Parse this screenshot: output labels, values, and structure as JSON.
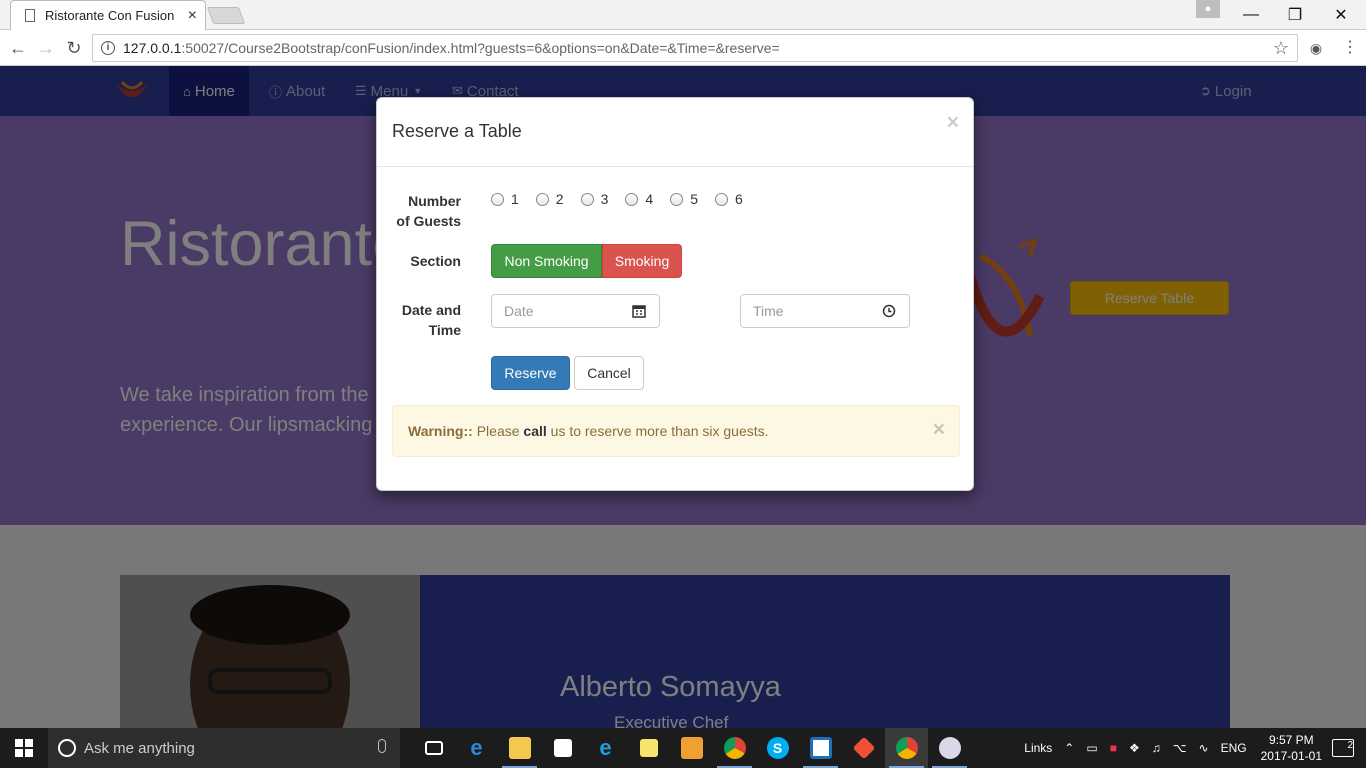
{
  "browser": {
    "tab_title": "Ristorante Con Fusion",
    "tab_close": "×",
    "url_host": "127.0.0.1",
    "url_rest": ":50027/Course2Bootstrap/conFusion/index.html?guests=6&options=on&Date=&Time=&reserve=",
    "window_controls": {
      "minimize": "—",
      "restore": "❐",
      "close": "✕"
    }
  },
  "navbar": {
    "items": [
      {
        "label": "Home",
        "icon": "home-icon",
        "active": true
      },
      {
        "label": "About",
        "icon": "info-icon"
      },
      {
        "label": "Menu",
        "icon": "list-icon"
      },
      {
        "label": "Contact",
        "icon": "envelope-icon"
      }
    ],
    "login_label": "Login"
  },
  "jumbotron": {
    "title": "Ristorante",
    "text_line1": "We take inspiration from the",
    "text_line2": "experience. Our lipsmacking",
    "button_label": "Reserve Table"
  },
  "leader": {
    "name": "Alberto Somayya",
    "title": "Executive Chef"
  },
  "modal": {
    "title": "Reserve a Table",
    "close": "×",
    "guests_label_1": "Number",
    "guests_label_2": "of Guests",
    "guest_options": [
      "1",
      "2",
      "3",
      "4",
      "5",
      "6"
    ],
    "section_label": "Section",
    "non_smoking_label": "Non Smoking",
    "smoking_label": "Smoking",
    "date_label_1": "Date and",
    "date_label_2": "Time",
    "date_placeholder": "Date",
    "time_placeholder": "Time",
    "reserve_label": "Reserve",
    "cancel_label": "Cancel",
    "warning_strong": "Warning::",
    "warning_pre": "Please",
    "warning_call": "call",
    "warning_post": "us to reserve more than six guests.",
    "warning_close": "×"
  },
  "taskbar": {
    "search_placeholder": "Ask me anything",
    "links_label": "Links",
    "language": "ENG",
    "time": "9:57 PM",
    "date": "2017-01-01",
    "notification_count": "2"
  },
  "colors": {
    "navbar": "#303F9F",
    "jumbotron": "#9575CD",
    "success": "#449d44",
    "danger": "#d9534f",
    "primary": "#337ab7",
    "warning_bg": "#fcf8e3"
  }
}
